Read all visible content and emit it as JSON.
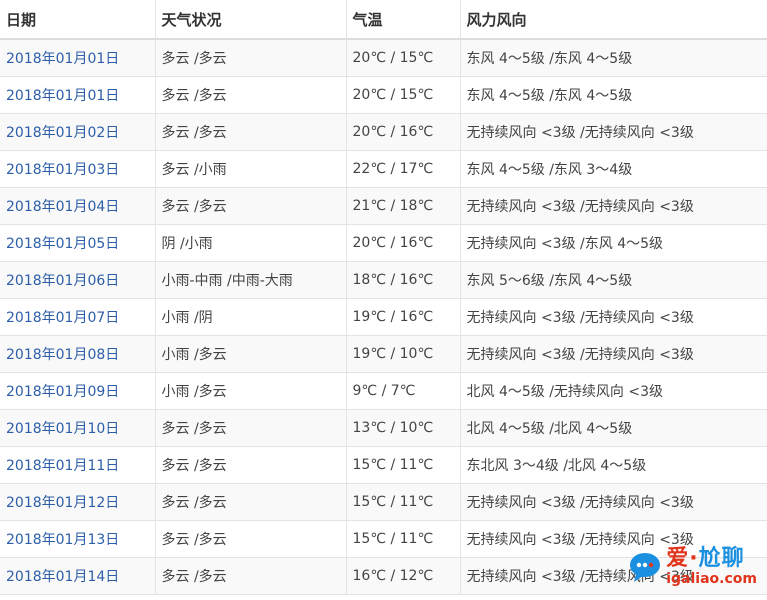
{
  "table": {
    "headers": [
      "日期",
      "天气状况",
      "气温",
      "风力风向"
    ],
    "rows": [
      {
        "date": "2018年01月01日",
        "condition": "多云 /多云",
        "temp": "20℃ / 15℃",
        "wind": "东风 4～5级 /东风 4～5级"
      },
      {
        "date": "2018年01月01日",
        "condition": "多云 /多云",
        "temp": "20℃ / 15℃",
        "wind": "东风 4～5级 /东风 4～5级"
      },
      {
        "date": "2018年01月02日",
        "condition": "多云 /多云",
        "temp": "20℃ / 16℃",
        "wind": "无持续风向 <3级 /无持续风向 <3级"
      },
      {
        "date": "2018年01月03日",
        "condition": "多云 /小雨",
        "temp": "22℃ / 17℃",
        "wind": "东风 4～5级 /东风 3～4级"
      },
      {
        "date": "2018年01月04日",
        "condition": "多云 /多云",
        "temp": "21℃ / 18℃",
        "wind": "无持续风向 <3级 /无持续风向 <3级"
      },
      {
        "date": "2018年01月05日",
        "condition": "阴 /小雨",
        "temp": "20℃ / 16℃",
        "wind": "无持续风向 <3级 /东风 4～5级"
      },
      {
        "date": "2018年01月06日",
        "condition": "小雨-中雨 /中雨-大雨",
        "temp": "18℃ / 16℃",
        "wind": "东风 5～6级 /东风 4～5级"
      },
      {
        "date": "2018年01月07日",
        "condition": "小雨 /阴",
        "temp": "19℃ / 16℃",
        "wind": "无持续风向 <3级 /无持续风向 <3级"
      },
      {
        "date": "2018年01月08日",
        "condition": "小雨 /多云",
        "temp": "19℃ / 10℃",
        "wind": "无持续风向 <3级 /无持续风向 <3级"
      },
      {
        "date": "2018年01月09日",
        "condition": "小雨 /多云",
        "temp": "9℃ / 7℃",
        "wind": "北风 4～5级 /无持续风向 <3级"
      },
      {
        "date": "2018年01月10日",
        "condition": "多云 /多云",
        "temp": "13℃ / 10℃",
        "wind": "北风 4～5级 /北风 4～5级"
      },
      {
        "date": "2018年01月11日",
        "condition": "多云 /多云",
        "temp": "15℃ / 11℃",
        "wind": "东北风 3～4级 /北风 4～5级"
      },
      {
        "date": "2018年01月12日",
        "condition": "多云 /多云",
        "temp": "15℃ / 11℃",
        "wind": "无持续风向 <3级 /无持续风向 <3级"
      },
      {
        "date": "2018年01月13日",
        "condition": "多云 /多云",
        "temp": "15℃ / 11℃",
        "wind": "无持续风向 <3级 /无持续风向 <3级"
      },
      {
        "date": "2018年01月14日",
        "condition": "多云 /多云",
        "temp": "16℃ / 12℃",
        "wind": "无持续风向 <3级 /无持续风向 <3级"
      }
    ]
  },
  "watermark": {
    "title_part1": "爱",
    "title_dot": "·",
    "title_part2": "尬聊",
    "url": "igaliao.com",
    "logo_icon": "speech-bubble-logo-icon",
    "colors": {
      "red": "#e2341c",
      "blue": "#1b8fe0"
    }
  },
  "colors": {
    "link": "#2d5ea8",
    "text": "#444444",
    "header_text": "#333333",
    "row_stripe": "#f9f9f9",
    "border": "#e2e2e2"
  }
}
